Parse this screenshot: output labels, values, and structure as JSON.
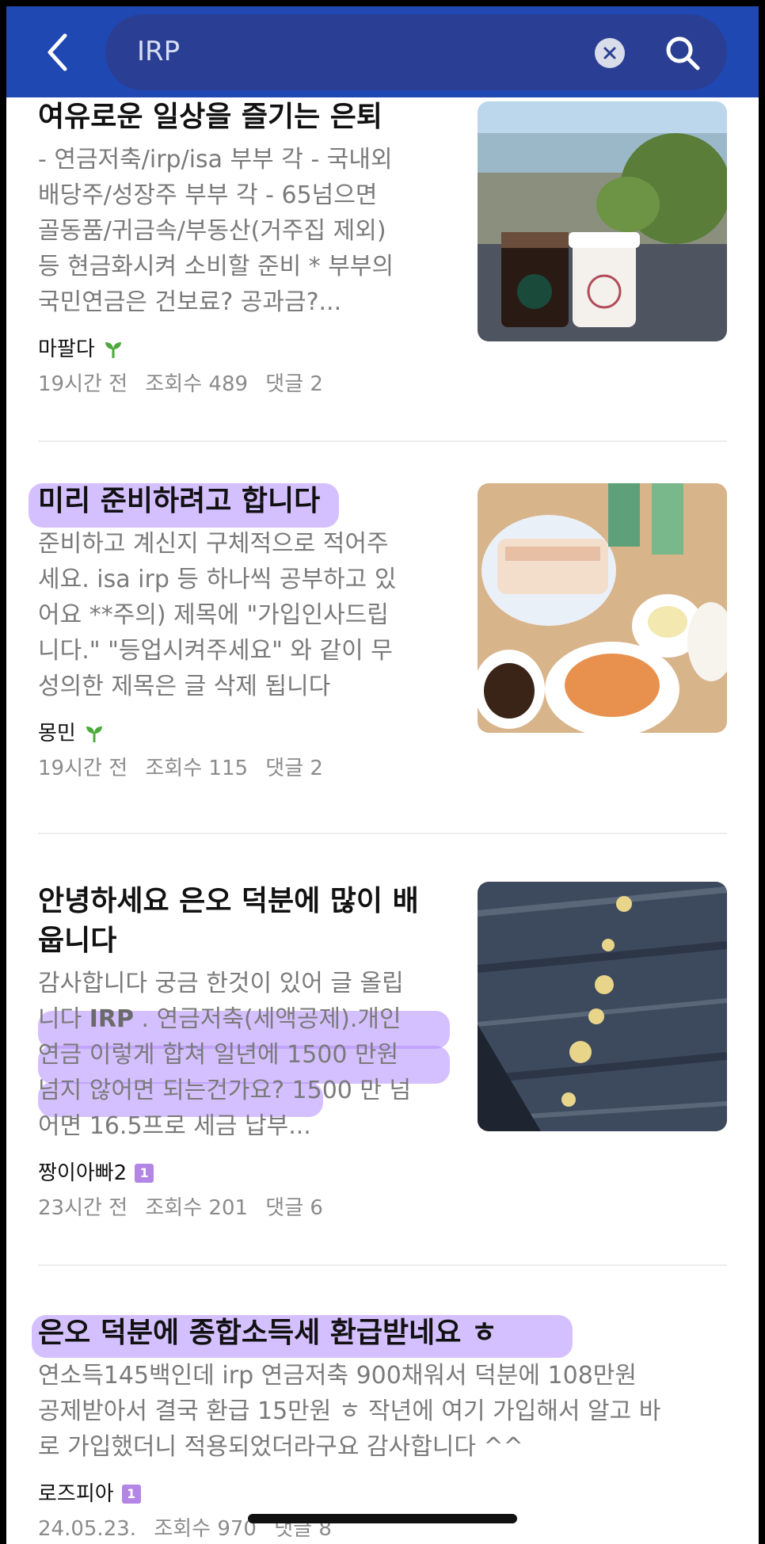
{
  "search": {
    "query": "IRP",
    "back_label": "back",
    "clear_label": "clear",
    "submit_label": "search"
  },
  "posts": [
    {
      "title": "여유로운 일상을 즐기는 은퇴",
      "excerpt_lines": [
        "- 연금저축/irp/isa 부부 각 - 국내외",
        "배당주/성장주 부부 각 - 65넘으면",
        "골동품/귀금속/부동산(거주집 제외)",
        "등 현금화시켜 소비할 준비 * 부부의",
        "국민연금은 건보료? 공과금?..."
      ],
      "author": "마팔다",
      "author_badge": "sprout-icon",
      "time": "19시간 전",
      "views": "조회수 489",
      "comments": "댓글 2",
      "thumbnail": "cafe-coffee-photo"
    },
    {
      "title": "미리 준비하려고 합니다",
      "excerpt_lines": [
        "준비하고 계신지 구체적으로 적어주",
        "세요. isa irp 등 하나씩 공부하고 있",
        "어요 **주의) 제목에 \"가입인사드립",
        "니다.\" \"등업시켜주세요\" 와 같이 무",
        "성의한 제목은 글 삭제 됩니다"
      ],
      "author": "몽민",
      "author_badge": "sprout-icon",
      "time": "19시간 전",
      "views": "조회수 115",
      "comments": "댓글 2",
      "thumbnail": "korean-food-table-photo"
    },
    {
      "title_lines": [
        "안녕하세요 은오 덕분에 많이 배",
        "웁니다"
      ],
      "excerpt_lines": [
        "감사합니다 궁금 한것이 있어 글 올립",
        "니다 ",
        "IRP",
        " . 연금저축(세액공제).개인",
        "연금 이렇게 합쳐 일년에 1500 만원",
        "넘지 않어면 되는건가요? 1500 만 넘",
        "어면 16.5프로 세금 납부..."
      ],
      "author": "짱이아빠2",
      "author_badge": "1",
      "time": "23시간 전",
      "views": "조회수 201",
      "comments": "댓글 6",
      "thumbnail": "wooden-bench-photo"
    },
    {
      "title": "은오 덕분에 종합소득세 환급받네요 ㅎ",
      "excerpt_lines": [
        "연소득145백인데 irp 연금저축 900채워서 덕분에 108만원",
        "공제받아서 결국 환급 15만원 ㅎ 작년에 여기 가입해서 알고 바",
        "로 가입했더니 적용되었더라구요 감사합니다 ^^"
      ],
      "author": "로즈피아",
      "author_badge": "1",
      "time": "24.05.23.",
      "views": "조회수 970",
      "comments": "댓글 8"
    }
  ]
}
